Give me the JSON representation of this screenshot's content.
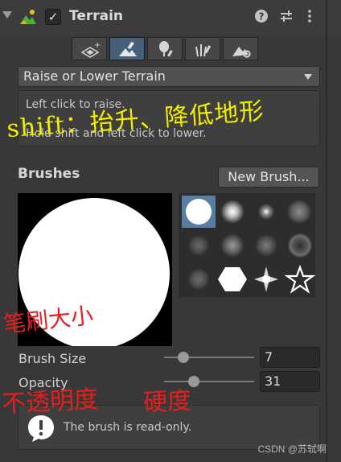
{
  "component": {
    "title": "Terrain",
    "enabled_check": "✓",
    "help_icon": "help-icon",
    "presets_icon": "presets-icon",
    "menu_icon": "kebab-icon"
  },
  "tools": [
    {
      "name": "create-neighbor-terrains",
      "selected": false
    },
    {
      "name": "paint-terrain",
      "selected": true
    },
    {
      "name": "paint-trees",
      "selected": false
    },
    {
      "name": "paint-details",
      "selected": false
    },
    {
      "name": "terrain-settings",
      "selected": false
    }
  ],
  "mode_dropdown": {
    "selected": "Raise or Lower Terrain"
  },
  "help_box": {
    "line1": "Left click to raise.",
    "line2": "Hold shift and left click to lower."
  },
  "brushes": {
    "heading": "Brushes",
    "new_brush_label": "New Brush...",
    "selected_index": 0
  },
  "brush_size": {
    "label": "Brush Size",
    "value": "7",
    "slider_fraction": 0.21
  },
  "opacity": {
    "label": "Opacity",
    "value": "31",
    "slider_fraction": 0.33
  },
  "notice": {
    "text": "The brush is read-only."
  },
  "annotations": {
    "shift_note": "shift：抬升、降低地形",
    "brush_size_note": "笔刷大小",
    "opacity_note": "不透明度",
    "hardness_note": "硬度"
  },
  "watermark": "CSDN @苏轼啊",
  "colors": {
    "panel_bg": "#383838",
    "selection_blue": "#46607c",
    "annotation_yellow": "#f2ee00",
    "annotation_red": "#e61e1e"
  }
}
